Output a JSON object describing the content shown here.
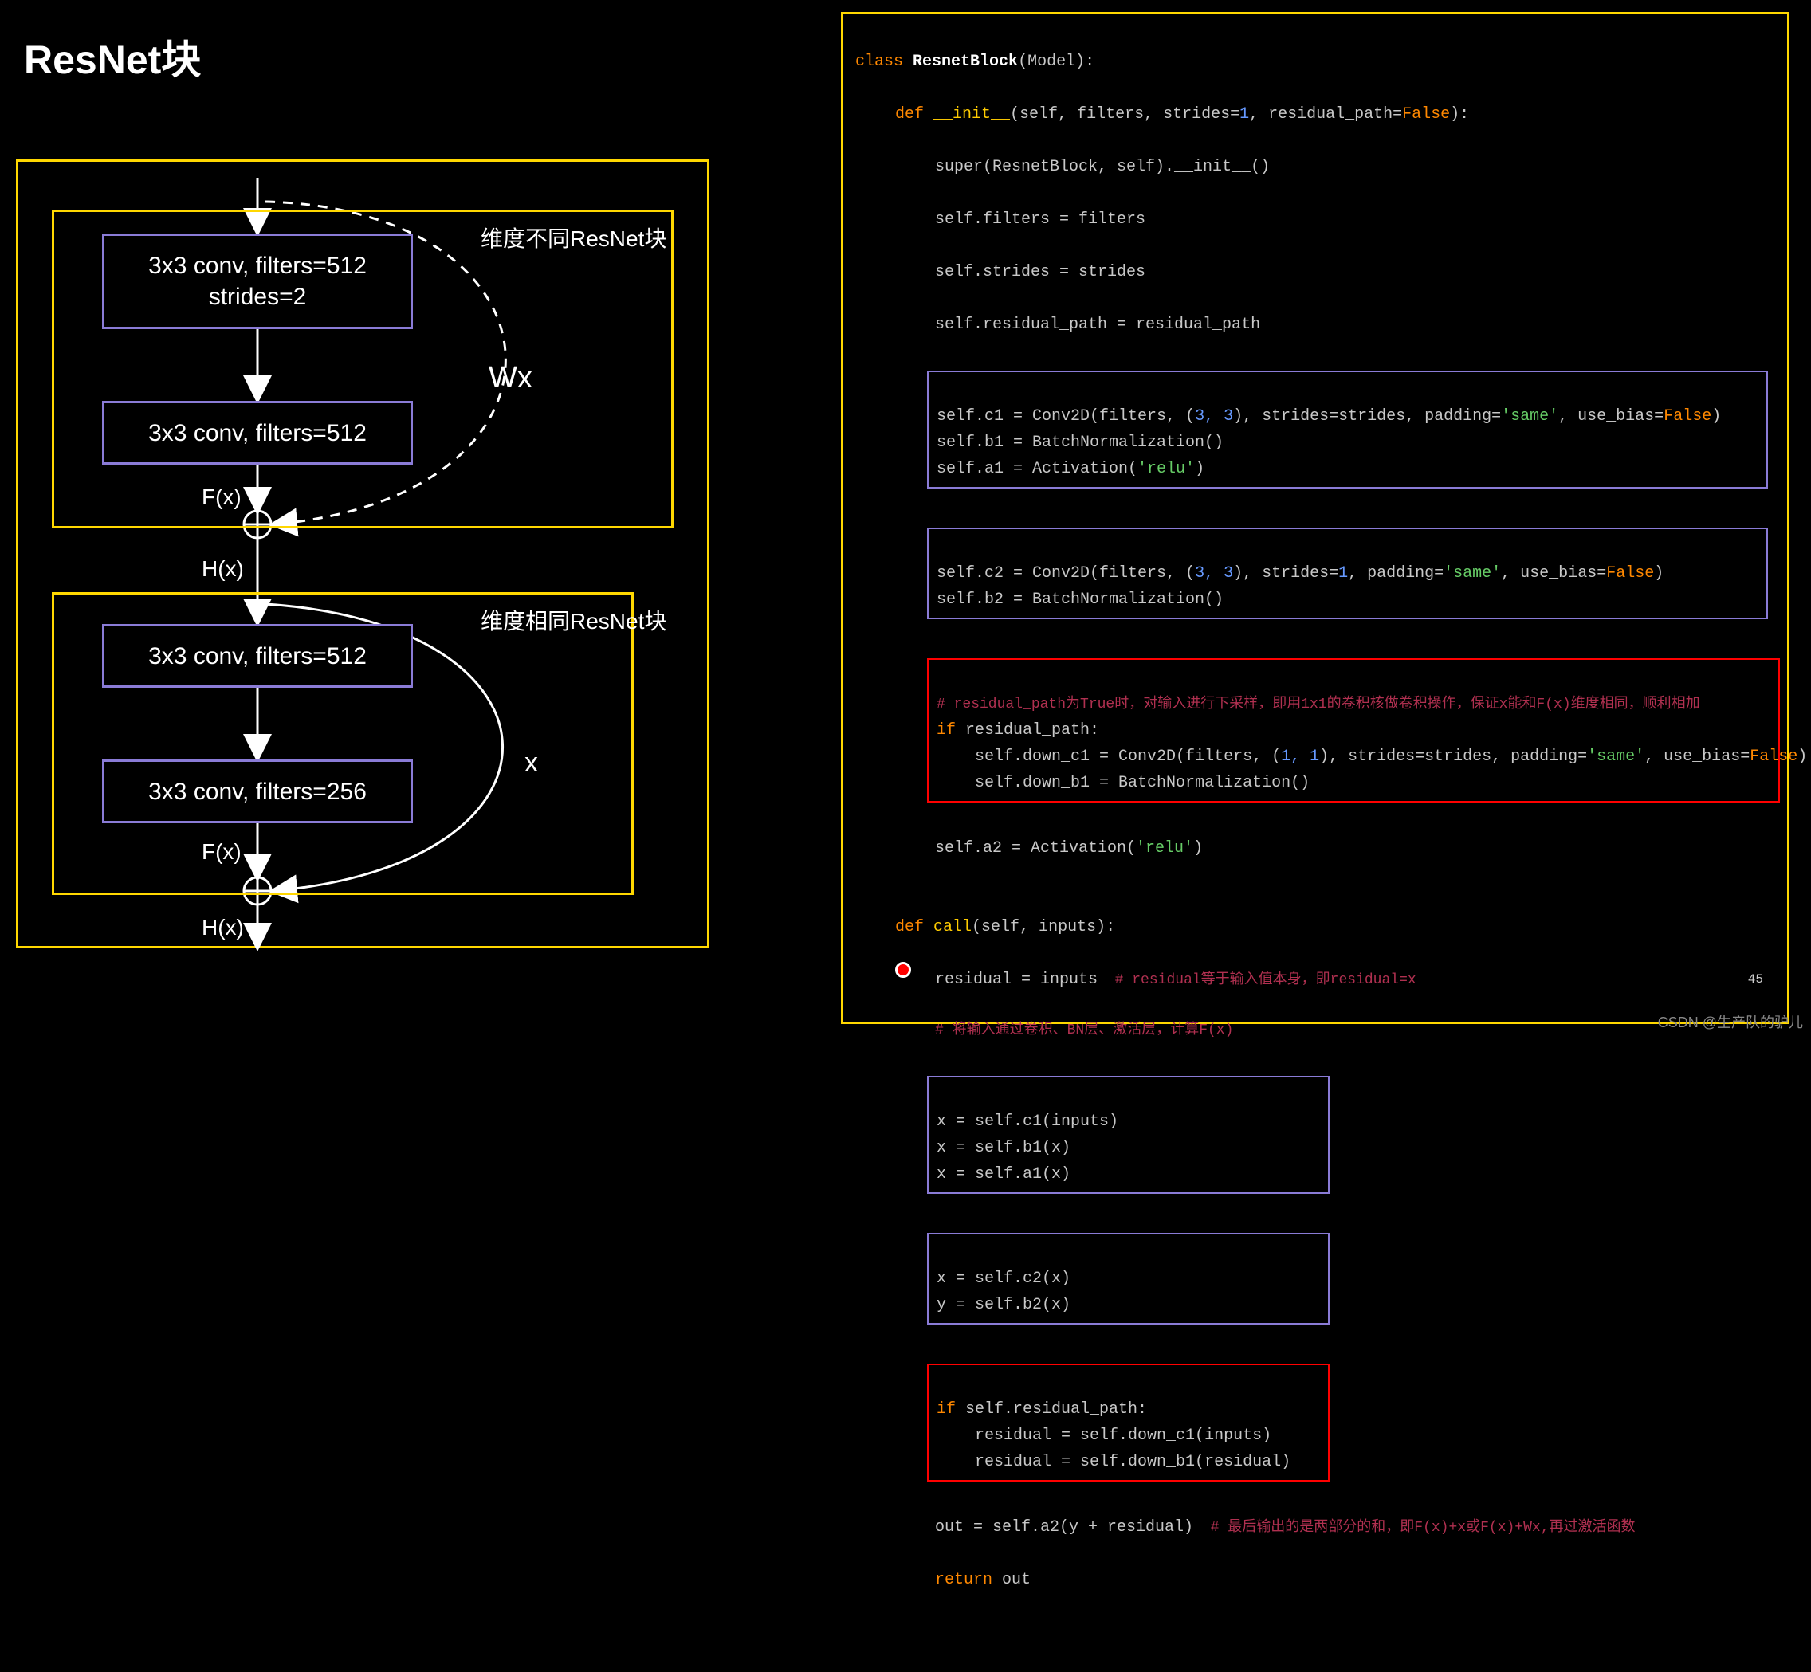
{
  "title": "ResNet块",
  "diagram": {
    "block1_label": "维度不同ResNet块",
    "block2_label": "维度相同ResNet块",
    "box1_line1": "3x3 conv, filters=512",
    "box1_line2": "strides=2",
    "box2": "3x3 conv, filters=512",
    "box3": "3x3 conv, filters=512",
    "box4": "3x3 conv, filters=256",
    "fx1": "F(x)",
    "hx1": "H(x)",
    "fx2": "F(x)",
    "hx2": "H(x)",
    "wx": "Wx",
    "x": "x"
  },
  "code": {
    "l1_class": "class",
    "l1_name": "ResnetBlock",
    "l1_base": "(Model):",
    "l2_def": "def",
    "l2_init": "__init__",
    "l2_sig": "(self, filters, strides=",
    "l2_one": "1",
    "l2_mid": ", residual_path=",
    "l2_false": "False",
    "l2_end": "):",
    "l3": "super(ResnetBlock, self).__init__()",
    "l4": "self.filters = filters",
    "l5": "self.strides = strides",
    "l6": "self.residual_path = residual_path",
    "b1_l1a": "self.c1 = Conv2D(filters, (",
    "b1_l1n": "3, 3",
    "b1_l1b": "), strides=strides, padding=",
    "b1_l1s": "'same'",
    "b1_l1c": ", use_bias=",
    "b1_l1f": "False",
    "b1_l1e": ")",
    "b1_l2": "self.b1 = BatchNormalization()",
    "b1_l3a": "self.a1 = Activation(",
    "b1_l3s": "'relu'",
    "b1_l3e": ")",
    "b2_l1a": "self.c2 = Conv2D(filters, (",
    "b2_l1n": "3, 3",
    "b2_l1b": "), strides=",
    "b2_l1o": "1",
    "b2_l1c": ", padding=",
    "b2_l1s": "'same'",
    "b2_l1d": ", use_bias=",
    "b2_l1f": "False",
    "b2_l1e": ")",
    "b2_l2": "self.b2 = BatchNormalization()",
    "r1_cmt": "# residual_path为True时，对输入进行下采样，即用1x1的卷积核做卷积操作，保证x能和F(x)维度相同，顺利相加",
    "r1_if": "if",
    "r1_cond": " residual_path:",
    "r1_l2a": "self.down_c1 = Conv2D(filters, (",
    "r1_l2n": "1, 1",
    "r1_l2b": "), strides=strides, padding=",
    "r1_l2s": "'same'",
    "r1_l2c": ", use_bias=",
    "r1_l2f": "False",
    "r1_l2e": ")",
    "r1_l3": "self.down_b1 = BatchNormalization()",
    "a2a": "self.a2 = Activation(",
    "a2s": "'relu'",
    "a2e": ")",
    "call_def": "def",
    "call_fn": "call",
    "call_sig": "(self, inputs):",
    "call_l1": "residual = inputs",
    "call_cmt1": "  # residual等于输入值本身，即residual=x",
    "call_cmt2": "# 将输入通过卷积、BN层、激活层，计算F(x)",
    "b3_l1": "x = self.c1(inputs)",
    "b3_l2": "x = self.b1(x)",
    "b3_l3": "x = self.a1(x)",
    "b4_l1": "x = self.c2(x)",
    "b4_l2": "y = self.b2(x)",
    "r2_if": "if",
    "r2_cond": " self.residual_path:",
    "r2_l2": "residual = self.down_c1(inputs)",
    "r2_l3": "residual = self.down_b1(residual)",
    "out_l1": "out = self.a2(y + residual)",
    "out_cmt": "  # 最后输出的是两部分的和，即F(x)+x或F(x)+Wx,再过激活函数",
    "ret": "return",
    "ret_v": " out"
  },
  "pagenum": "45",
  "watermark": "CSDN @生产队的驴儿"
}
